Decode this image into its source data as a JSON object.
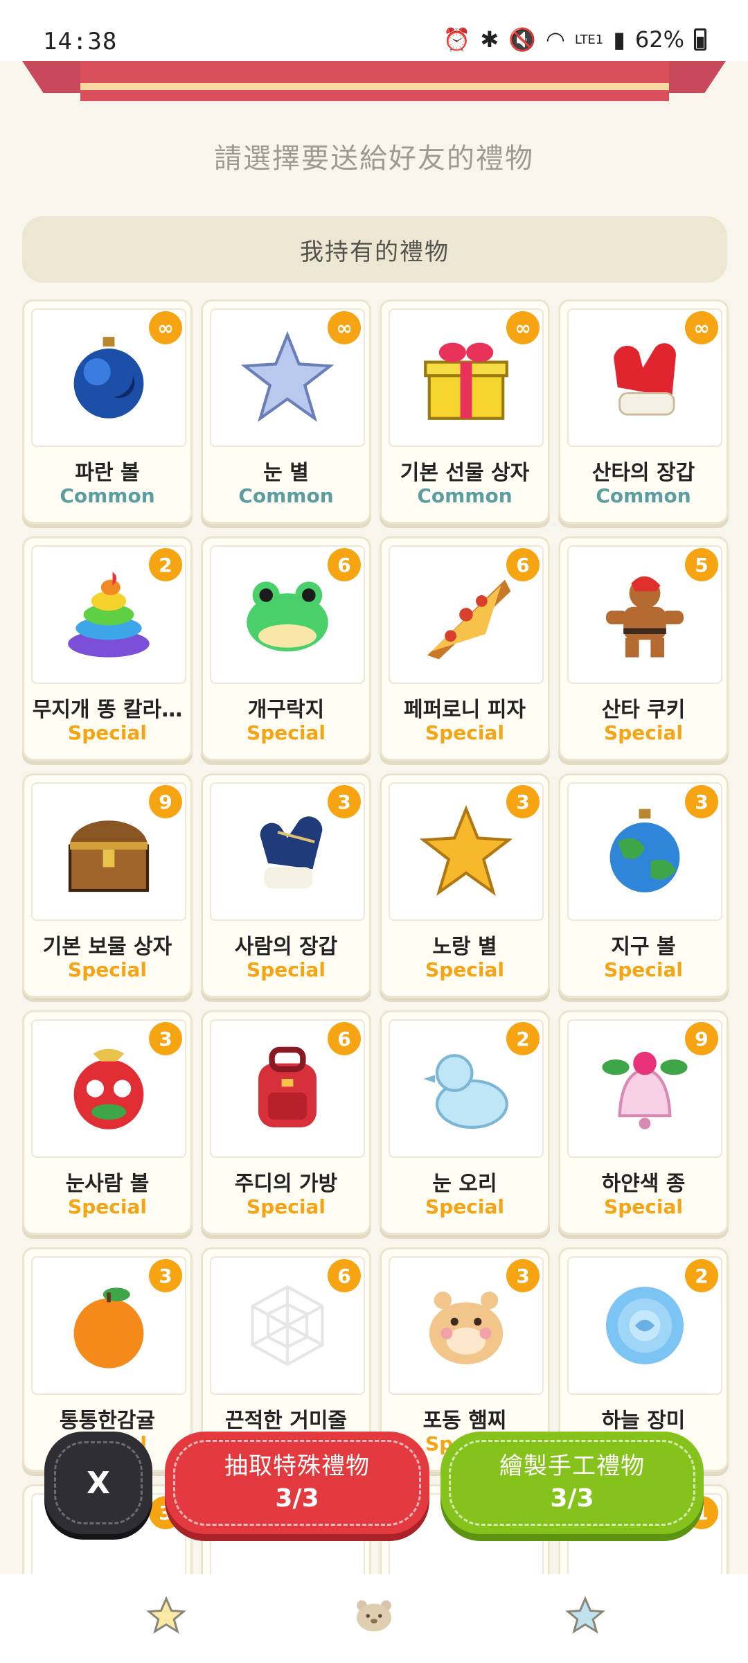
{
  "status_bar": {
    "time": "14:38",
    "network": "LTE1",
    "battery": "62%"
  },
  "prompt": "請選擇要送給好友的禮物",
  "section_title": "我持有的禮物",
  "gifts": [
    {
      "name": "파란 볼",
      "rarity": "Common",
      "qty": "∞",
      "icon": "blue-ornament-icon"
    },
    {
      "name": "눈 별",
      "rarity": "Common",
      "qty": "∞",
      "icon": "snow-star-icon"
    },
    {
      "name": "기본 선물 상자",
      "rarity": "Common",
      "qty": "∞",
      "icon": "gift-box-icon"
    },
    {
      "name": "산타의 장갑",
      "rarity": "Common",
      "qty": "∞",
      "icon": "red-mitten-icon"
    },
    {
      "name": "무지개 똥 칼라…",
      "rarity": "Special",
      "qty": "2",
      "icon": "rainbow-poop-icon"
    },
    {
      "name": "개구락지",
      "rarity": "Special",
      "qty": "6",
      "icon": "frog-icon"
    },
    {
      "name": "페퍼로니 피자",
      "rarity": "Special",
      "qty": "6",
      "icon": "pizza-icon"
    },
    {
      "name": "산타 쿠키",
      "rarity": "Special",
      "qty": "5",
      "icon": "gingerbread-icon"
    },
    {
      "name": "기본 보물 상자",
      "rarity": "Special",
      "qty": "9",
      "icon": "treasure-chest-icon"
    },
    {
      "name": "사람의 장갑",
      "rarity": "Special",
      "qty": "3",
      "icon": "blue-mitten-icon"
    },
    {
      "name": "노랑 별",
      "rarity": "Special",
      "qty": "3",
      "icon": "yellow-star-icon"
    },
    {
      "name": "지구 볼",
      "rarity": "Special",
      "qty": "3",
      "icon": "earth-ornament-icon"
    },
    {
      "name": "눈사람 볼",
      "rarity": "Special",
      "qty": "3",
      "icon": "snowman-ornament-icon"
    },
    {
      "name": "주디의 가방",
      "rarity": "Special",
      "qty": "6",
      "icon": "backpack-icon"
    },
    {
      "name": "눈 오리",
      "rarity": "Special",
      "qty": "2",
      "icon": "snow-duck-icon"
    },
    {
      "name": "하얀색 종",
      "rarity": "Special",
      "qty": "9",
      "icon": "bell-icon"
    },
    {
      "name": "통통한감귤",
      "rarity": "Special",
      "qty": "3",
      "icon": "tangerine-icon"
    },
    {
      "name": "끈적한 거미줄",
      "rarity": "Special",
      "qty": "6",
      "icon": "spiderweb-icon"
    },
    {
      "name": "포동 햄찌",
      "rarity": "Special",
      "qty": "3",
      "icon": "hamster-icon"
    },
    {
      "name": "하늘 장미",
      "rarity": "Special",
      "qty": "2",
      "icon": "sky-rose-icon"
    }
  ],
  "partial_row_badges": [
    "3",
    "",
    "",
    "1"
  ],
  "buttons": {
    "close_label": "X",
    "draw_label": "抽取特殊禮物",
    "draw_count": "3/3",
    "craft_label": "繪製手工禮物",
    "craft_count": "3/3"
  },
  "nav": [
    "star-tab-icon",
    "bear-tab-icon",
    "blue-star-tab-icon"
  ]
}
